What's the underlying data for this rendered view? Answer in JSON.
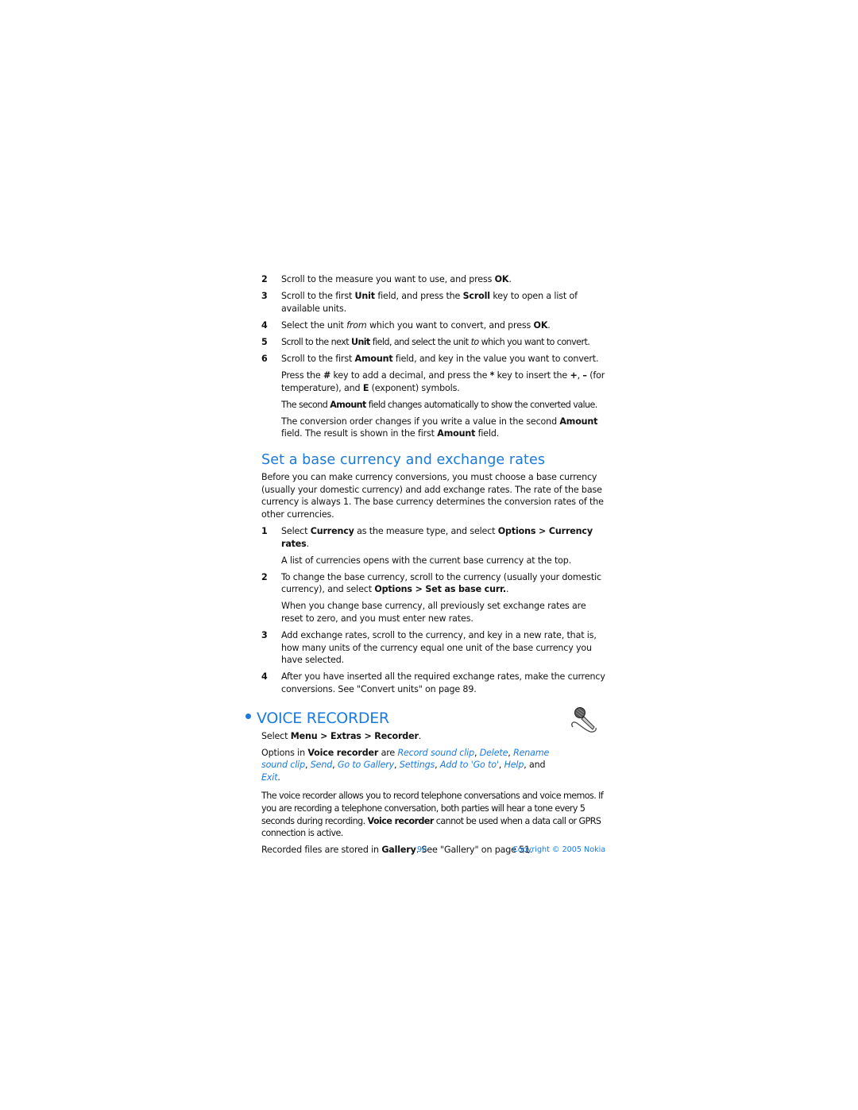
{
  "steps_top": [
    {
      "num": "2",
      "parts": [
        [
          "Scroll to the measure you want to use, and press ",
          ""
        ],
        [
          "OK",
          "b"
        ],
        [
          ".",
          ""
        ]
      ]
    },
    {
      "num": "3",
      "parts": [
        [
          "Scroll to the first ",
          ""
        ],
        [
          "Unit",
          "b"
        ],
        [
          " field, and press the ",
          ""
        ],
        [
          "Scroll",
          "b"
        ],
        [
          " key to open a list of available units.",
          ""
        ]
      ]
    },
    {
      "num": "4",
      "parts": [
        [
          "Select the unit ",
          ""
        ],
        [
          "from",
          "i"
        ],
        [
          " which you want to convert, and press ",
          ""
        ],
        [
          "OK",
          "b"
        ],
        [
          ".",
          ""
        ]
      ]
    },
    {
      "num": "5",
      "cond": true,
      "parts": [
        [
          "Scroll to the next ",
          ""
        ],
        [
          "Unit",
          "b"
        ],
        [
          " field, and select the unit ",
          ""
        ],
        [
          "to",
          "i"
        ],
        [
          " which you want to convert.",
          ""
        ]
      ]
    },
    {
      "num": "6",
      "parts": [
        [
          "Scroll to the first ",
          ""
        ],
        [
          "Amount",
          "b"
        ],
        [
          " field, and key in the value you want to convert.",
          ""
        ]
      ]
    }
  ],
  "notes_top": [
    {
      "parts": [
        [
          "Press the ",
          ""
        ],
        [
          "#",
          "b"
        ],
        [
          " key to add a decimal, and press the ",
          ""
        ],
        [
          "*",
          "b"
        ],
        [
          " key to insert the ",
          ""
        ],
        [
          "+",
          "b"
        ],
        [
          ", ",
          ""
        ],
        [
          "–",
          "b"
        ],
        [
          " (for temperature), and ",
          ""
        ],
        [
          "E",
          "b"
        ],
        [
          " (exponent) symbols.",
          ""
        ]
      ]
    },
    {
      "cond": true,
      "parts": [
        [
          "The second ",
          ""
        ],
        [
          "Amount",
          "b"
        ],
        [
          " field changes automatically to show the converted value.",
          ""
        ]
      ]
    },
    {
      "parts": [
        [
          "The conversion order changes if you write a value in the second ",
          ""
        ],
        [
          "Amount",
          "b"
        ],
        [
          " field. The result is shown in the first ",
          ""
        ],
        [
          "Amount",
          "b"
        ],
        [
          " field.",
          ""
        ]
      ]
    }
  ],
  "currency_section": {
    "heading": "Set a base currency and exchange rates",
    "intro": "Before you can make currency conversions, you must choose a base currency (usually your domestic currency) and add exchange rates. The rate of the base currency is always 1. The base currency determines the conversion rates of the other currencies.",
    "steps": [
      {
        "num": "1",
        "parts": [
          [
            "Select ",
            ""
          ],
          [
            "Currency",
            "b"
          ],
          [
            " as the measure type, and select ",
            ""
          ],
          [
            "Options > Currency rates",
            "b"
          ],
          [
            ".",
            ""
          ]
        ],
        "note": [
          [
            "A list of currencies opens with the current base currency at the top.",
            ""
          ]
        ]
      },
      {
        "num": "2",
        "parts": [
          [
            "To change the base currency, scroll to the currency (usually your domestic currency), and select ",
            ""
          ],
          [
            "Options > Set as base curr.",
            "b"
          ],
          [
            ".",
            ""
          ]
        ],
        "note": [
          [
            "When you change base currency, all previously set exchange rates are reset to zero, and you must enter new rates.",
            ""
          ]
        ]
      },
      {
        "num": "3",
        "parts": [
          [
            "Add exchange rates, scroll to the currency, and key in a new rate, that is, how many units of the currency equal one unit of the base currency you have selected.",
            ""
          ]
        ]
      },
      {
        "num": "4",
        "parts": [
          [
            "After you have inserted all the required exchange rates, make the currency conversions. See \"Convert units\" on page 89.",
            ""
          ]
        ]
      }
    ]
  },
  "voice_section": {
    "heading": "VOICE RECORDER",
    "icon": "microphone-icon",
    "select": [
      [
        "Select ",
        ""
      ],
      [
        "Menu > Extras > Recorder",
        "b"
      ],
      [
        ".",
        ""
      ]
    ],
    "options": [
      [
        "Options in ",
        ""
      ],
      [
        "Voice recorder",
        "b"
      ],
      [
        " are ",
        ""
      ],
      [
        "Record sound clip",
        "bi"
      ],
      [
        ", ",
        ""
      ],
      [
        "Delete",
        "bi"
      ],
      [
        ", ",
        ""
      ],
      [
        "Rename sound clip",
        "bi"
      ],
      [
        ", ",
        ""
      ],
      [
        "Send",
        "bi"
      ],
      [
        ", ",
        ""
      ],
      [
        "Go to Gallery",
        "bi"
      ],
      [
        ", ",
        ""
      ],
      [
        "Settings",
        "bi"
      ],
      [
        ", ",
        ""
      ],
      [
        "Add to 'Go to'",
        "bi"
      ],
      [
        ", ",
        ""
      ],
      [
        "Help",
        "bi"
      ],
      [
        ", and ",
        ""
      ],
      [
        "Exit",
        "bi"
      ],
      [
        ".",
        ""
      ]
    ],
    "body": [
      [
        "The voice recorder allows you to record telephone conversations and voice memos. If you are recording a telephone conversation, both parties will hear a tone every 5 seconds during recording. ",
        ""
      ],
      [
        "Voice recorder",
        "b"
      ],
      [
        " cannot be used when a data call or GPRS connection is active.",
        ""
      ]
    ],
    "stored": [
      [
        "Recorded files are stored in ",
        ""
      ],
      [
        "Gallery",
        "b"
      ],
      [
        ". See \"Gallery\" on page 51.",
        ""
      ]
    ]
  },
  "footer": {
    "page_number": "90",
    "copyright": "Copyright © 2005 Nokia"
  },
  "colors": {
    "accent": "#1a7ae0",
    "text": "#111111"
  }
}
